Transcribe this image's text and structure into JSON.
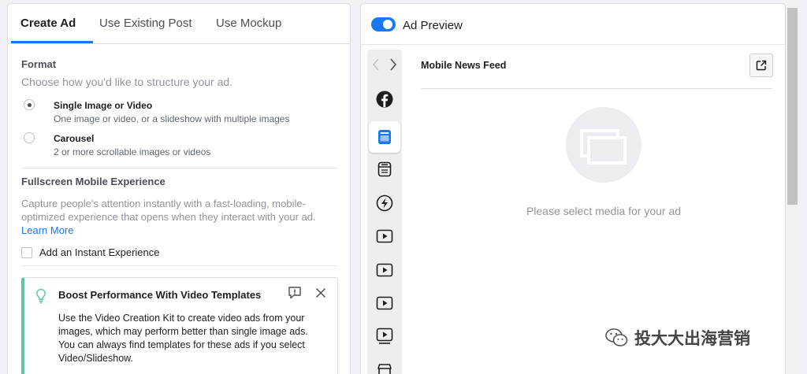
{
  "left_panel": {
    "tabs": [
      {
        "label": "Create Ad",
        "active": true
      },
      {
        "label": "Use Existing Post",
        "active": false
      },
      {
        "label": "Use Mockup",
        "active": false
      }
    ],
    "format": {
      "title": "Format",
      "subtitle": "Choose how you'd like to structure your ad.",
      "options": [
        {
          "label": "Single Image or Video",
          "description": "One image or video, or a slideshow with multiple images",
          "selected": true
        },
        {
          "label": "Carousel",
          "description": "2 or more scrollable images or videos",
          "selected": false
        }
      ]
    },
    "fullscreen": {
      "title": "Fullscreen Mobile Experience",
      "description": "Capture people's attention instantly with a fast-loading, mobile-optimized experience that opens when they interact with your ad.",
      "link": "Learn More",
      "checkbox_label": "Add an Instant Experience",
      "checked": false
    },
    "boost": {
      "title": "Boost Performance With Video Templates",
      "text": "Use the Video Creation Kit to create video ads from your images, which may perform better than single image ads. You can always find templates for these ads if you select Video/Slideshow.",
      "accent": "#5bc7a8"
    }
  },
  "right_panel": {
    "toggle_label": "Ad Preview",
    "toggle_on": true,
    "placement_title": "Mobile News Feed",
    "empty_message": "Please select media for your ad",
    "rail_icons": [
      "facebook-icon",
      "news-feed-icon",
      "story-icon",
      "instant-articles-icon",
      "video-icon",
      "video-icon",
      "video-icon",
      "video-feed-icon",
      "marketplace-icon"
    ]
  },
  "watermark": {
    "text": "投大大出海营销"
  },
  "colors": {
    "accent": "#1877f2",
    "muted": "#90949c",
    "rail": "#eceef1"
  }
}
